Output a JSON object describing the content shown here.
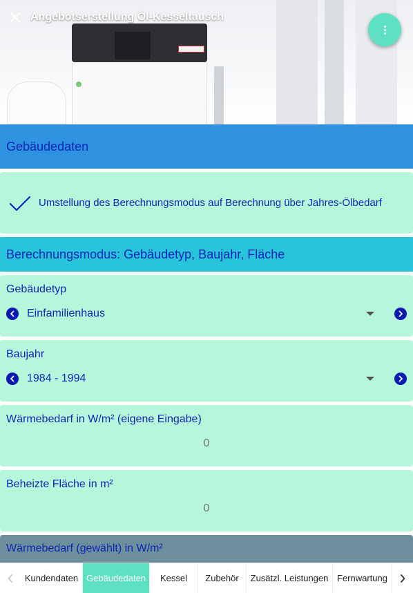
{
  "header": {
    "title": "Angebotserstellung Öl-Kesseltausch"
  },
  "sections": {
    "gebaeudedaten_title": "Gebäudedaten",
    "notice_text": "Umstellung des Berechnungsmodus auf Berechnung über Jahres-Ölbedarf",
    "mode_title": "Berechnungsmodus: Gebäudetyp, Baujahr, Fläche",
    "waermebedarf_gewaehlt_title": "Wärmebedarf (gewählt) in W/m²"
  },
  "fields": {
    "gebaeudetyp": {
      "label": "Gebäudetyp",
      "value": "Einfamilienhaus"
    },
    "baujahr": {
      "label": "Baujahr",
      "value": "1984 - 1994"
    },
    "waermebedarf": {
      "label": "Wärmebedarf in W/m² (eigene Eingabe)",
      "placeholder": "0"
    },
    "flaeche": {
      "label": "Beheizte Fläche in m²",
      "placeholder": "0"
    }
  },
  "tabs": [
    {
      "label": "Kundendaten",
      "active": false
    },
    {
      "label": "Gebäudedaten",
      "active": true
    },
    {
      "label": "Kessel",
      "active": false
    },
    {
      "label": "Zubehör",
      "active": false
    },
    {
      "label": "Zusätzl. Leistungen",
      "active": false
    },
    {
      "label": "Fernwartung",
      "active": false
    }
  ],
  "colors": {
    "accent": "#5ee0c3",
    "blue_section": "#2e92e0",
    "cyan_section": "#27c4dc",
    "mint_card": "#b6f7db",
    "gray_section": "#6d8f9b",
    "text_blue": "#0e25b8"
  },
  "icons": {
    "close": "close-icon",
    "menu": "more-vert-icon",
    "check": "check-icon",
    "prev": "chevron-left-icon",
    "next": "chevron-right-icon",
    "dropdown": "caret-down-icon"
  }
}
